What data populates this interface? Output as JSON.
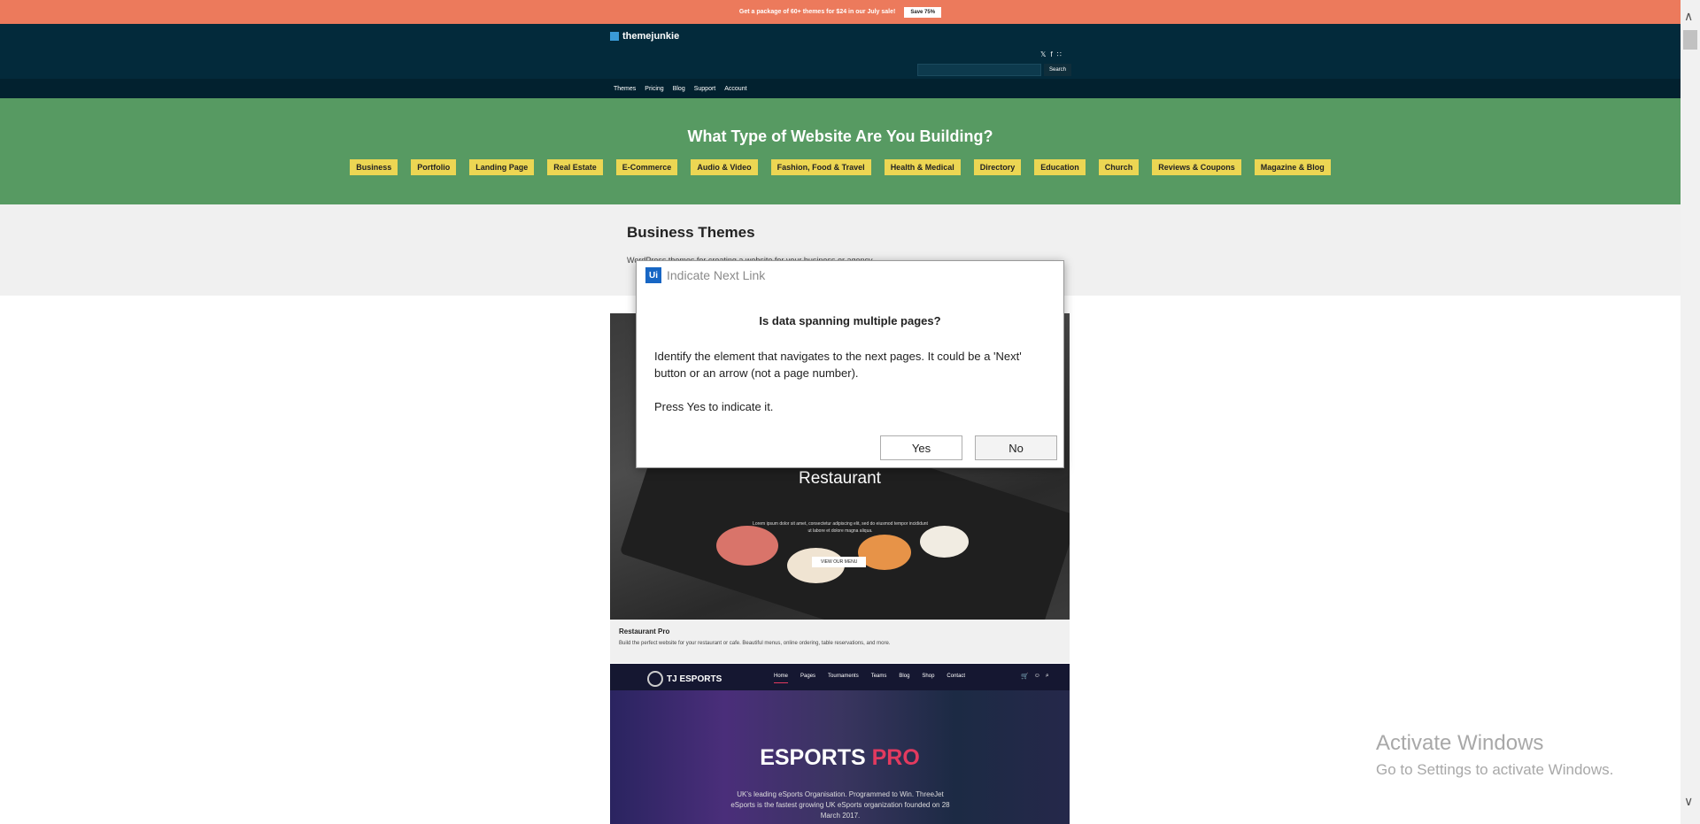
{
  "promo": {
    "text": "Get a package of 60+ themes for $24 in our July sale!",
    "button": "Save 75%"
  },
  "header": {
    "logo": "themejunkie",
    "social": [
      "twitter-icon",
      "facebook-icon",
      "rss-icon"
    ],
    "search_button": "Search"
  },
  "nav": {
    "items": [
      {
        "label": "Themes"
      },
      {
        "label": "Pricing"
      },
      {
        "label": "Blog"
      },
      {
        "label": "Support"
      },
      {
        "label": "Account"
      }
    ]
  },
  "hero": {
    "title": "What Type of Website Are You Building?",
    "categories": [
      {
        "label": "Business"
      },
      {
        "label": "Portfolio"
      },
      {
        "label": "Landing Page"
      },
      {
        "label": "Real Estate"
      },
      {
        "label": "E-Commerce"
      },
      {
        "label": "Audio & Video"
      },
      {
        "label": "Fashion, Food & Travel"
      },
      {
        "label": "Health & Medical"
      },
      {
        "label": "Directory"
      },
      {
        "label": "Education"
      },
      {
        "label": "Church"
      },
      {
        "label": "Reviews & Coupons"
      },
      {
        "label": "Magazine & Blog"
      }
    ]
  },
  "section": {
    "title": "Business Themes",
    "description": "WordPress themes for creating a website for your business or agency."
  },
  "cards": [
    {
      "preview_heading": "Restaurant",
      "preview_text": "Lorem ipsum dolor sit amet, consectetur adipiscing elit, sed do eiusmod tempor incididunt ut labore et dolore magna aliqua.",
      "preview_button": "VIEW OUR MENU",
      "name": "Restaurant Pro",
      "description": "Build the perfect website for your restaurant or cafe. Beautiful menus, online ordering, table reservations, and more."
    },
    {
      "preview_logo": "TJ ESPORTS",
      "preview_menu": [
        "Home",
        "Pages",
        "Tournaments",
        "Teams",
        "Blog",
        "Shop",
        "Contact"
      ],
      "preview_title_main": "ESPORTS",
      "preview_title_accent": "PRO",
      "preview_text": "UK's leading eSports Organisation. Programmed to Win. ThreeJet eSports is the fastest growing UK eSports organization founded on 28 March 2017."
    }
  ],
  "dialog": {
    "app_icon": "Ui",
    "title": "Indicate Next Link",
    "question": "Is data spanning multiple pages?",
    "body": "Identify the element that navigates to the next pages. It could be a 'Next' button or an arrow (not a page number).",
    "instruction": "Press Yes to indicate it.",
    "yes": "Yes",
    "no": "No"
  },
  "watermark": {
    "title": "Activate Windows",
    "subtitle": "Go to Settings to activate Windows."
  },
  "colors": {
    "promo": "#ec7a5c",
    "header": "#032a3b",
    "hero": "#579a62",
    "category": "#ecd653",
    "dialog_icon": "#1766c4",
    "esports_accent": "#e33a5f"
  }
}
